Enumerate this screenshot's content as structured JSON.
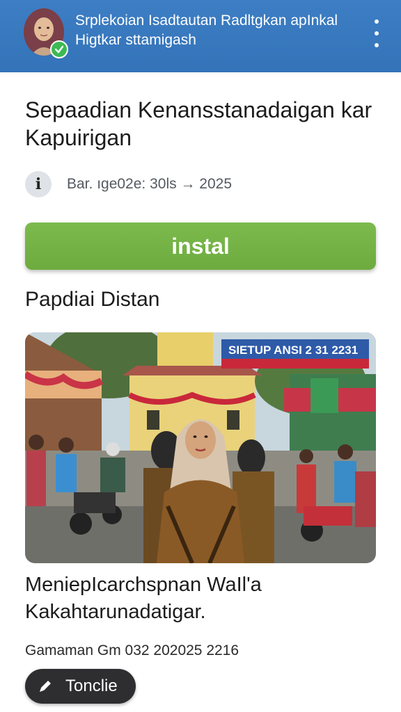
{
  "header": {
    "title": "Srplekoian Isadtautan Radltgkan apInkal Higtkar sttamigash",
    "avatar_icon": "profile-avatar",
    "verified_icon": "check-badge-icon",
    "menu_icon": "more-vert-icon",
    "background": "#3a79bf"
  },
  "page": {
    "title": "Sepaadian Kenansstanadaigan kar Kapuirigan",
    "info_icon": "info-icon",
    "meta": "Bar. ıge02e: 30ls → 2025"
  },
  "install": {
    "label": "instal",
    "color": "#74b347"
  },
  "section": {
    "title": "Papdiai Distan"
  },
  "photo": {
    "banner_text": "SIETUP ANSI 2 31 2231"
  },
  "post": {
    "caption": "MeniepIcarchspnan WaIl'a Kakahtarunadatigar.",
    "date": "Gamaman Gm 032 202025 2216",
    "edit_label": "Tonclie",
    "edit_icon": "pencil-icon"
  }
}
